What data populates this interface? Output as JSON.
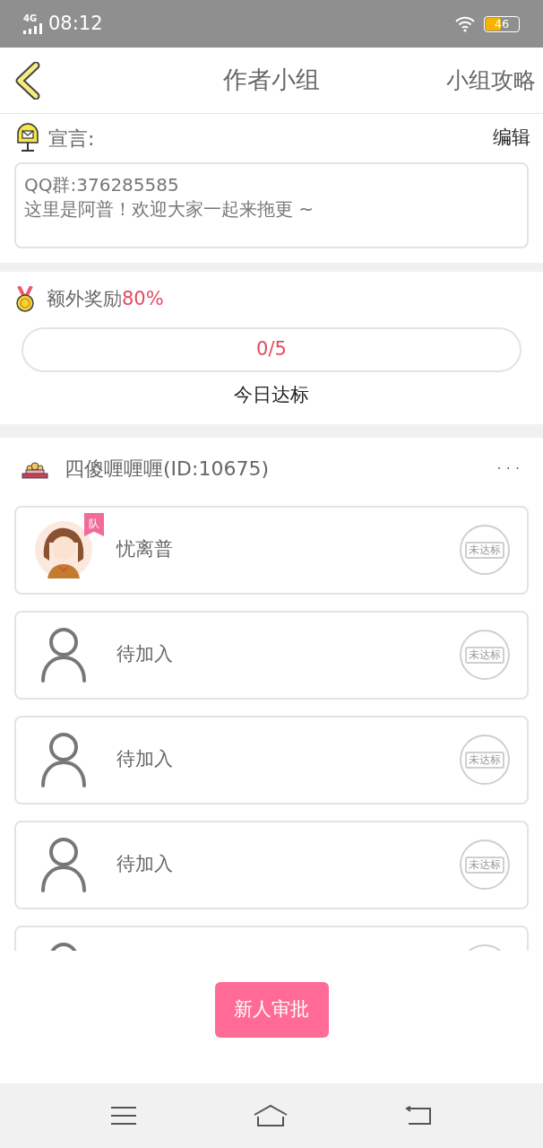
{
  "status_bar": {
    "network": "4G",
    "time": "08:12",
    "battery": "46"
  },
  "header": {
    "title": "作者小组",
    "action": "小组攻略"
  },
  "manifesto": {
    "label": "宣言:",
    "edit": "编辑",
    "lines": [
      "QQ群:376285585",
      "这里是阿普！欢迎大家一起来拖更 ~"
    ]
  },
  "bonus": {
    "label": "额外奖励",
    "percent": "80%",
    "progress": "0/5",
    "level": 0,
    "caption": "今日达标"
  },
  "group": {
    "name": "四傻喱喱喱(ID:10675)",
    "more": "· · ·",
    "members": [
      {
        "kind": "member",
        "name": "忧离普",
        "badge": "队",
        "status": "未达标"
      },
      {
        "kind": "empty",
        "name": "待加入",
        "status": "未达标"
      },
      {
        "kind": "empty",
        "name": "待加入",
        "status": "未达标"
      },
      {
        "kind": "empty",
        "name": "待加入",
        "status": "未达标"
      },
      {
        "kind": "empty"
      }
    ]
  },
  "approve_button": "新人审批"
}
